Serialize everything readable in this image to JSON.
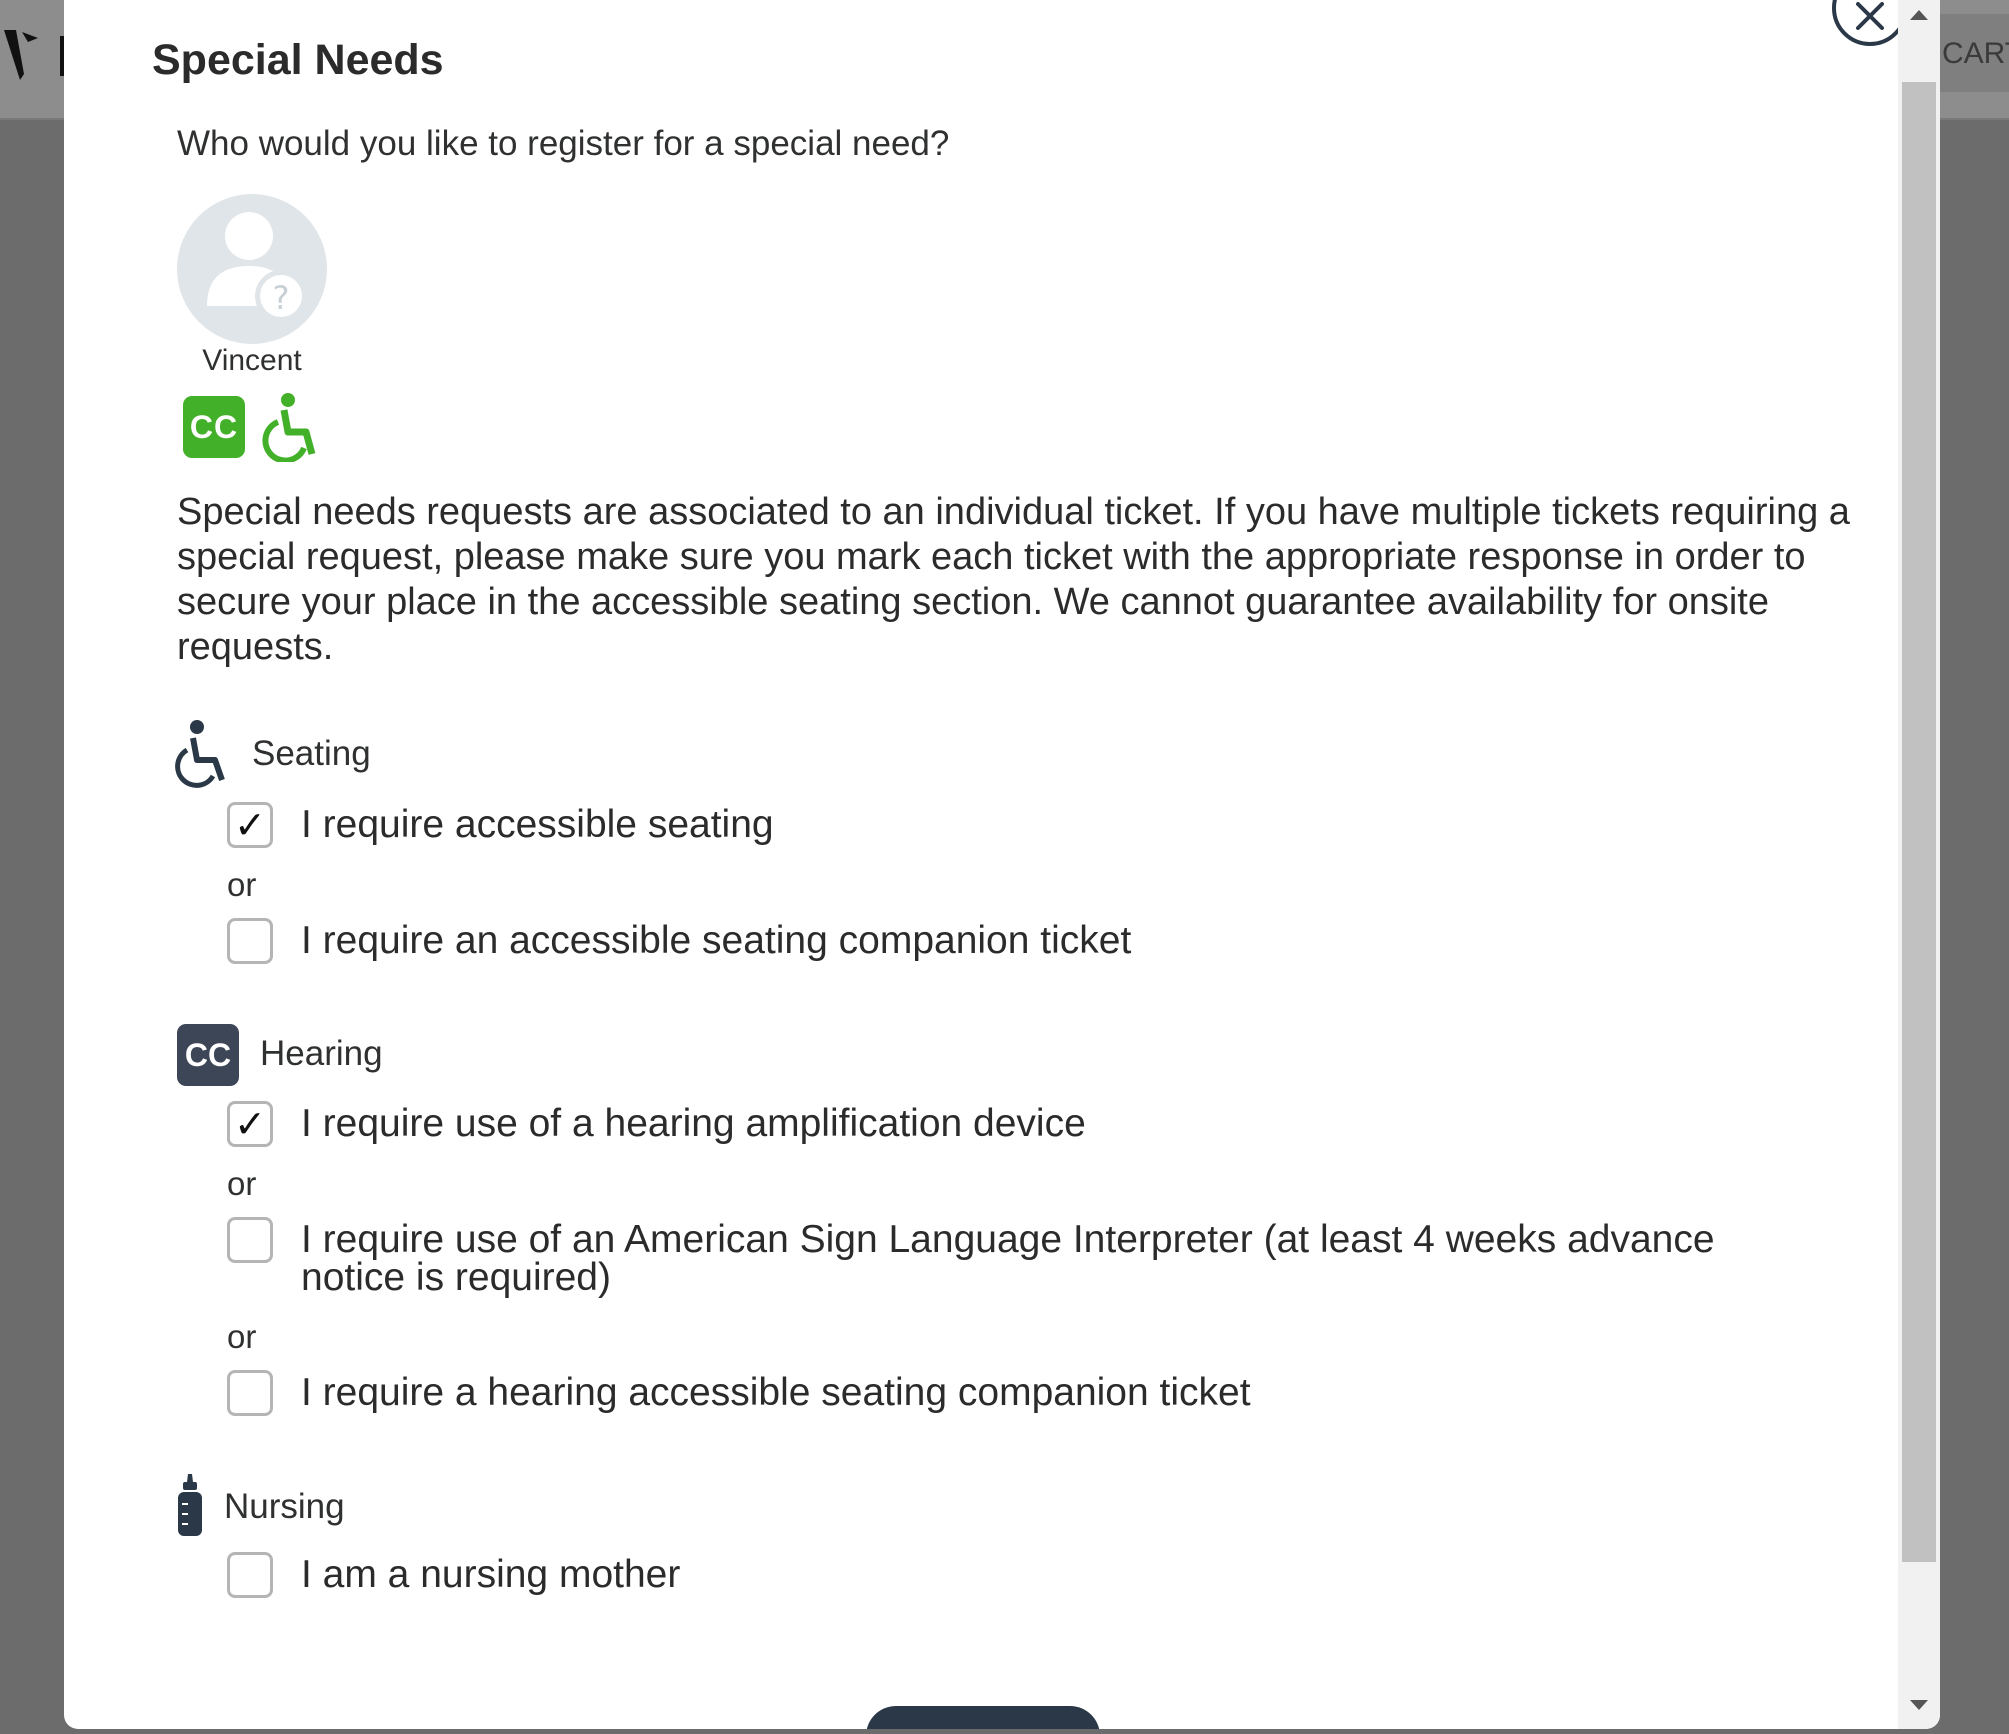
{
  "background": {
    "cart_label": "CART"
  },
  "modal": {
    "title": "Special Needs",
    "prompt": "Who would you like to register for a special need?",
    "attendee": {
      "name": "Vincent",
      "avatar_icon": "user-unknown-icon",
      "badges": [
        "cc-badge",
        "wheelchair-badge"
      ],
      "cc_text": "CC"
    },
    "info": "Special needs requests are associated to an individual ticket. If you have multiple tickets requiring a special request, please make sure you mark each ticket with the appropriate response in order to secure your place in the accessible seating section. We cannot guarantee availability for onsite requests.",
    "or_text": "or",
    "sections": {
      "seating": {
        "label": "Seating",
        "icon": "wheelchair-icon",
        "options": [
          {
            "label": "I require accessible seating",
            "checked": true
          },
          {
            "label": "I require an accessible seating companion ticket",
            "checked": false
          }
        ]
      },
      "hearing": {
        "label": "Hearing",
        "icon": "closed-caption-icon",
        "icon_text": "CC",
        "options": [
          {
            "label": "I require use of a hearing amplification device",
            "checked": true
          },
          {
            "label": "I require use of an American Sign Language Interpreter (at least 4 weeks advance notice is required)",
            "checked": false
          },
          {
            "label": "I require a hearing accessible seating companion ticket",
            "checked": false
          }
        ]
      },
      "nursing": {
        "label": "Nursing",
        "icon": "baby-bottle-icon",
        "options": [
          {
            "label": "I am a nursing mother",
            "checked": false
          }
        ]
      }
    },
    "check_glyph": "✓"
  },
  "colors": {
    "accent_green": "#43b02a",
    "dark_navy": "#2b3848"
  }
}
